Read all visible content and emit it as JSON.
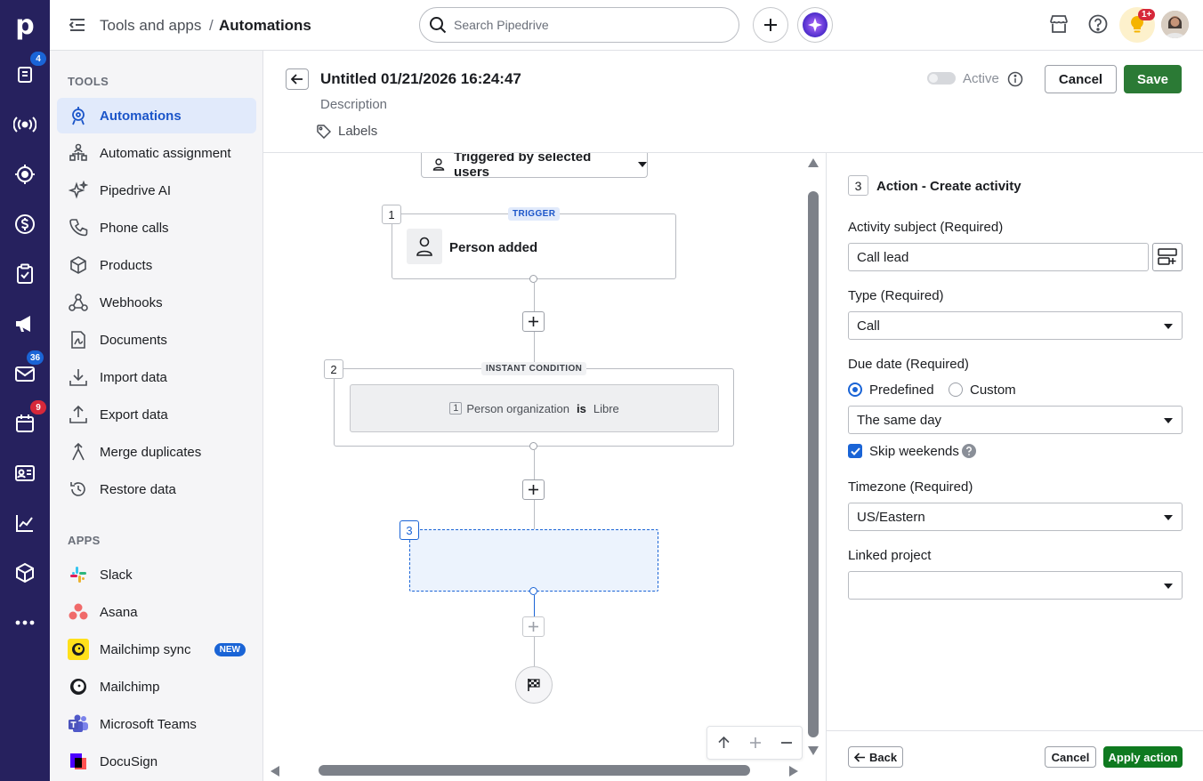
{
  "app": {
    "logo": "p",
    "colors": {
      "rail": "#26215e",
      "accent": "#1a64d6",
      "save": "#2b7a35",
      "apply": "#0f7a20",
      "badge_blue": "#1a64d6",
      "badge_red": "#d6283a"
    }
  },
  "rail": {
    "items": [
      {
        "icon": "leads-inbox-icon",
        "badge": "4"
      },
      {
        "icon": "broadcast-icon",
        "badge": ""
      },
      {
        "icon": "target-icon",
        "badge": ""
      },
      {
        "icon": "deals-dollar-icon",
        "badge": ""
      },
      {
        "icon": "activities-clipboard-icon",
        "badge": ""
      },
      {
        "icon": "campaigns-megaphone-icon",
        "badge": ""
      },
      {
        "icon": "mail-icon",
        "badge": "36"
      },
      {
        "icon": "calendar-icon",
        "badge": "9"
      },
      {
        "icon": "contacts-card-icon",
        "badge": ""
      },
      {
        "icon": "insights-chart-icon",
        "badge": ""
      },
      {
        "icon": "products-box-icon",
        "badge": ""
      },
      {
        "icon": "more-icon",
        "badge": ""
      }
    ]
  },
  "topbar": {
    "breadcrumb_parent": "Tools and apps",
    "breadcrumb_sep": "/",
    "breadcrumb_current": "Automations",
    "search_placeholder": "Search Pipedrive",
    "notification_badge": "1+"
  },
  "sidebar": {
    "tools_heading": "TOOLS",
    "tools": [
      {
        "label": "Automations",
        "icon": "automations-icon",
        "active": true
      },
      {
        "label": "Automatic assignment",
        "icon": "assignment-icon"
      },
      {
        "label": "Pipedrive AI",
        "icon": "sparkle-icon"
      },
      {
        "label": "Phone calls",
        "icon": "phone-icon"
      },
      {
        "label": "Products",
        "icon": "box-icon"
      },
      {
        "label": "Webhooks",
        "icon": "webhook-icon"
      },
      {
        "label": "Documents",
        "icon": "document-icon"
      },
      {
        "label": "Import data",
        "icon": "import-icon"
      },
      {
        "label": "Export data",
        "icon": "export-icon"
      },
      {
        "label": "Merge duplicates",
        "icon": "merge-icon"
      },
      {
        "label": "Restore data",
        "icon": "restore-icon"
      }
    ],
    "apps_heading": "APPS",
    "apps": [
      {
        "label": "Slack",
        "icon": "slack-icon"
      },
      {
        "label": "Asana",
        "icon": "asana-icon"
      },
      {
        "label": "Mailchimp sync",
        "icon": "mailchimp-icon",
        "badge": "NEW"
      },
      {
        "label": "Mailchimp",
        "icon": "mailchimp-icon"
      },
      {
        "label": "Microsoft Teams",
        "icon": "teams-icon"
      },
      {
        "label": "DocuSign",
        "icon": "docusign-icon"
      }
    ]
  },
  "editor": {
    "title": "Untitled 01/21/2026 16:24:47",
    "description_placeholder": "Description",
    "labels": "Labels",
    "active_label": "Active",
    "active_state": false,
    "cancel": "Cancel",
    "save": "Save"
  },
  "canvas": {
    "triggered_by": "Triggered by selected users",
    "step1": {
      "num": "1",
      "tag": "TRIGGER",
      "label": "Person added"
    },
    "step2": {
      "num": "2",
      "tag": "INSTANT CONDITION",
      "cond_index": "1",
      "cond_field": "Person organization",
      "cond_op": "is",
      "cond_value": "Libre"
    },
    "step3": {
      "num": "3"
    }
  },
  "panel": {
    "step_num": "3",
    "title": "Action - Create activity",
    "subject_label": "Activity subject (Required)",
    "subject_value": "Call lead",
    "type_label": "Type (Required)",
    "type_value": "Call",
    "due_label": "Due date (Required)",
    "due_option_predefined": "Predefined",
    "due_option_custom": "Custom",
    "due_selected": "Predefined",
    "due_value": "The same day",
    "skip_weekends": "Skip weekends",
    "skip_weekends_checked": true,
    "timezone_label": "Timezone (Required)",
    "timezone_value": "US/Eastern",
    "linked_label": "Linked project",
    "linked_value": "",
    "back": "Back",
    "cancel": "Cancel",
    "apply": "Apply action"
  }
}
